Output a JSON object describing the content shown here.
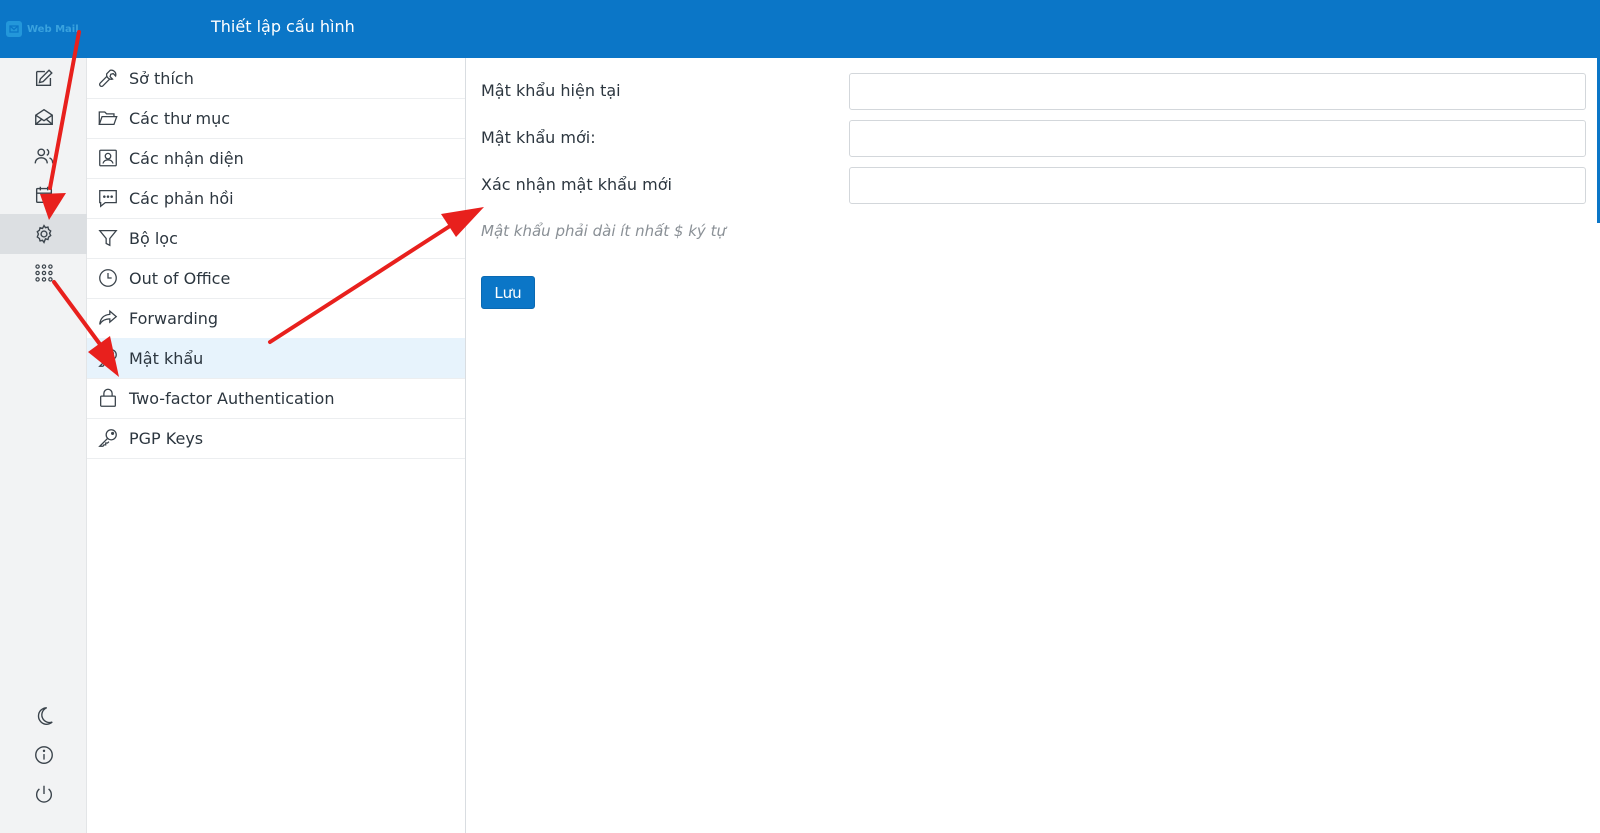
{
  "header": {
    "logo_text": "Web Mail",
    "title": "Thiết lập cấu hình"
  },
  "rail": {
    "top_items": [
      {
        "icon": "compose-icon"
      },
      {
        "icon": "mail-icon"
      },
      {
        "icon": "contacts-icon"
      },
      {
        "icon": "calendar-icon"
      },
      {
        "icon": "settings-icon",
        "active": true
      },
      {
        "icon": "apps-grid-icon"
      }
    ],
    "bottom_items": [
      {
        "icon": "dark-mode-icon"
      },
      {
        "icon": "about-icon"
      },
      {
        "icon": "logout-icon"
      }
    ]
  },
  "settings_list": [
    {
      "label": "Sở thích",
      "icon": "wrench-icon"
    },
    {
      "label": "Các thư mục",
      "icon": "folder-icon"
    },
    {
      "label": "Các nhận diện",
      "icon": "identity-card-icon"
    },
    {
      "label": "Các phản hồi",
      "icon": "comment-icon"
    },
    {
      "label": "Bộ lọc",
      "icon": "filter-icon"
    },
    {
      "label": "Out of Office",
      "icon": "clock-icon"
    },
    {
      "label": "Forwarding",
      "icon": "forward-icon"
    },
    {
      "label": "Mật khẩu",
      "icon": "key-icon",
      "selected": true
    },
    {
      "label": "Two-factor Authentication",
      "icon": "lock-icon"
    },
    {
      "label": "PGP Keys",
      "icon": "key-icon"
    }
  ],
  "form": {
    "current_password_label": "Mật khẩu hiện tại",
    "current_password_value": "",
    "new_password_label": "Mật khẩu mới:",
    "new_password_value": "",
    "confirm_password_label": "Xác nhận mật khẩu mới",
    "confirm_password_value": "",
    "hint": "Mật khẩu phải dài ít nhất $ ký tự",
    "save_label": "Lưu"
  },
  "colors": {
    "header_bg": "#0b76c7",
    "selected_item_bg": "#e7f3fc",
    "annotation_arrow": "#e8201d"
  }
}
